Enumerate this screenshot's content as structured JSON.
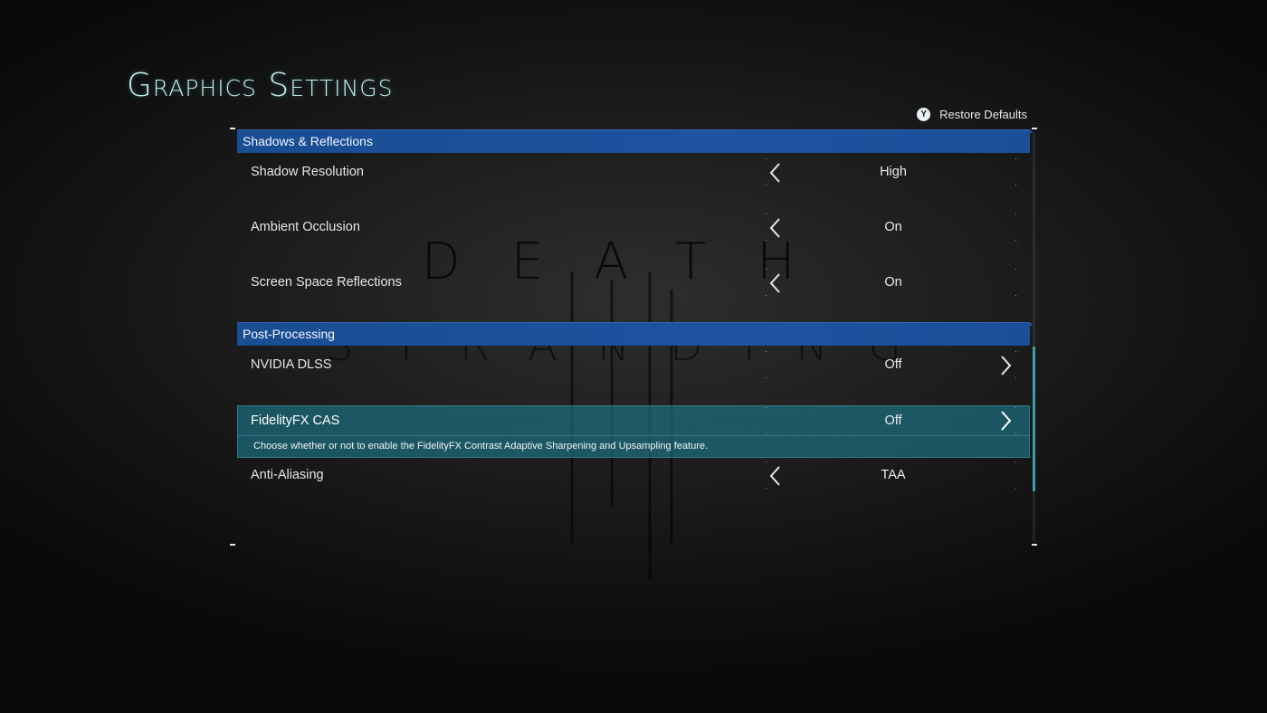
{
  "page": {
    "title": "Graphics Settings"
  },
  "restore_defaults": {
    "button_glyph": "Y",
    "label": "Restore Defaults"
  },
  "background": {
    "logo_line1": "DEATH",
    "logo_line2": "STRANDING"
  },
  "sections": [
    {
      "header": "Shadows & Reflections",
      "settings": [
        {
          "name": "Shadow Resolution",
          "value": "High",
          "left_arrow": true,
          "right_arrow": false
        },
        {
          "name": "Ambient Occlusion",
          "value": "On",
          "left_arrow": true,
          "right_arrow": false
        },
        {
          "name": "Screen Space Reflections",
          "value": "On",
          "left_arrow": true,
          "right_arrow": false
        }
      ]
    },
    {
      "header": "Post-Processing",
      "settings": [
        {
          "name": "NVIDIA DLSS",
          "value": "Off",
          "left_arrow": false,
          "right_arrow": true
        },
        {
          "name": "FidelityFX CAS",
          "value": "Off",
          "left_arrow": false,
          "right_arrow": true,
          "selected": true,
          "description": "Choose whether or not to enable the FidelityFX Contrast Adaptive Sharpening and Upsampling feature."
        },
        {
          "name": "Anti-Aliasing",
          "value": "TAA",
          "left_arrow": true,
          "right_arrow": false
        }
      ]
    }
  ],
  "colors": {
    "title": "#bff1ee",
    "section_header": "#1d53a0",
    "selected_row": "#18788c",
    "scroll_thumb": "#3a9fa8"
  },
  "icons": {
    "left": "chevron-left-icon",
    "right": "chevron-right-icon",
    "y_button": "y-button-icon"
  }
}
